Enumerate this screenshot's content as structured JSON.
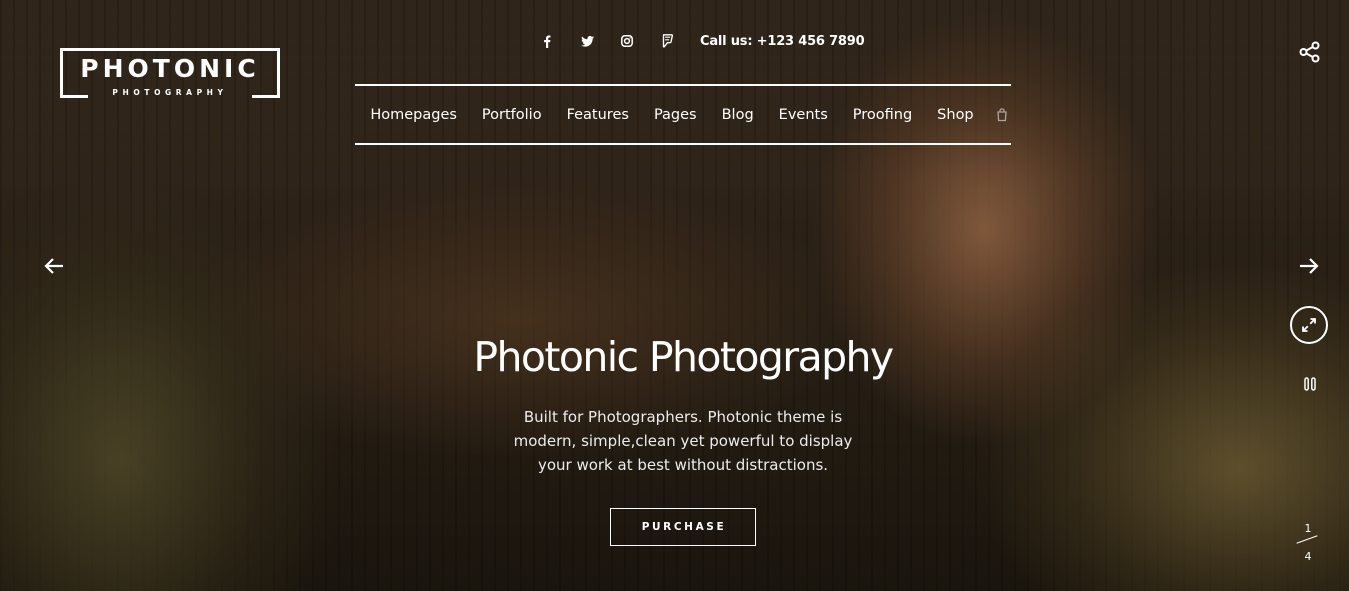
{
  "logo": {
    "main": "PHOTONIC",
    "sub": "PHOTOGRAPHY"
  },
  "topbar": {
    "icons": [
      "facebook-icon",
      "twitter-icon",
      "instagram-icon",
      "foursquare-icon"
    ],
    "phone": "Call us: +123 456 7890"
  },
  "nav": {
    "items": [
      "Homepages",
      "Portfolio",
      "Features",
      "Pages",
      "Blog",
      "Events",
      "Proofing",
      "Shop"
    ],
    "search_icon": "search-icon"
  },
  "slide": {
    "title": "Photonic Photography",
    "description": "Built for Photographers. Photonic theme is modern, simple,clean yet powerful to display your work at best without distractions.",
    "button_label": "PURCHASE"
  },
  "controls": {
    "share_icon": "share-icon",
    "prev_icon": "arrow-left-icon",
    "next_icon": "arrow-right-icon",
    "fullscreen_icon": "fullscreen-icon",
    "pause_icon": "pause-icon",
    "current": "1",
    "total": "4"
  },
  "colors": {
    "text": "#ffffff",
    "overlay": "#2e2318"
  }
}
